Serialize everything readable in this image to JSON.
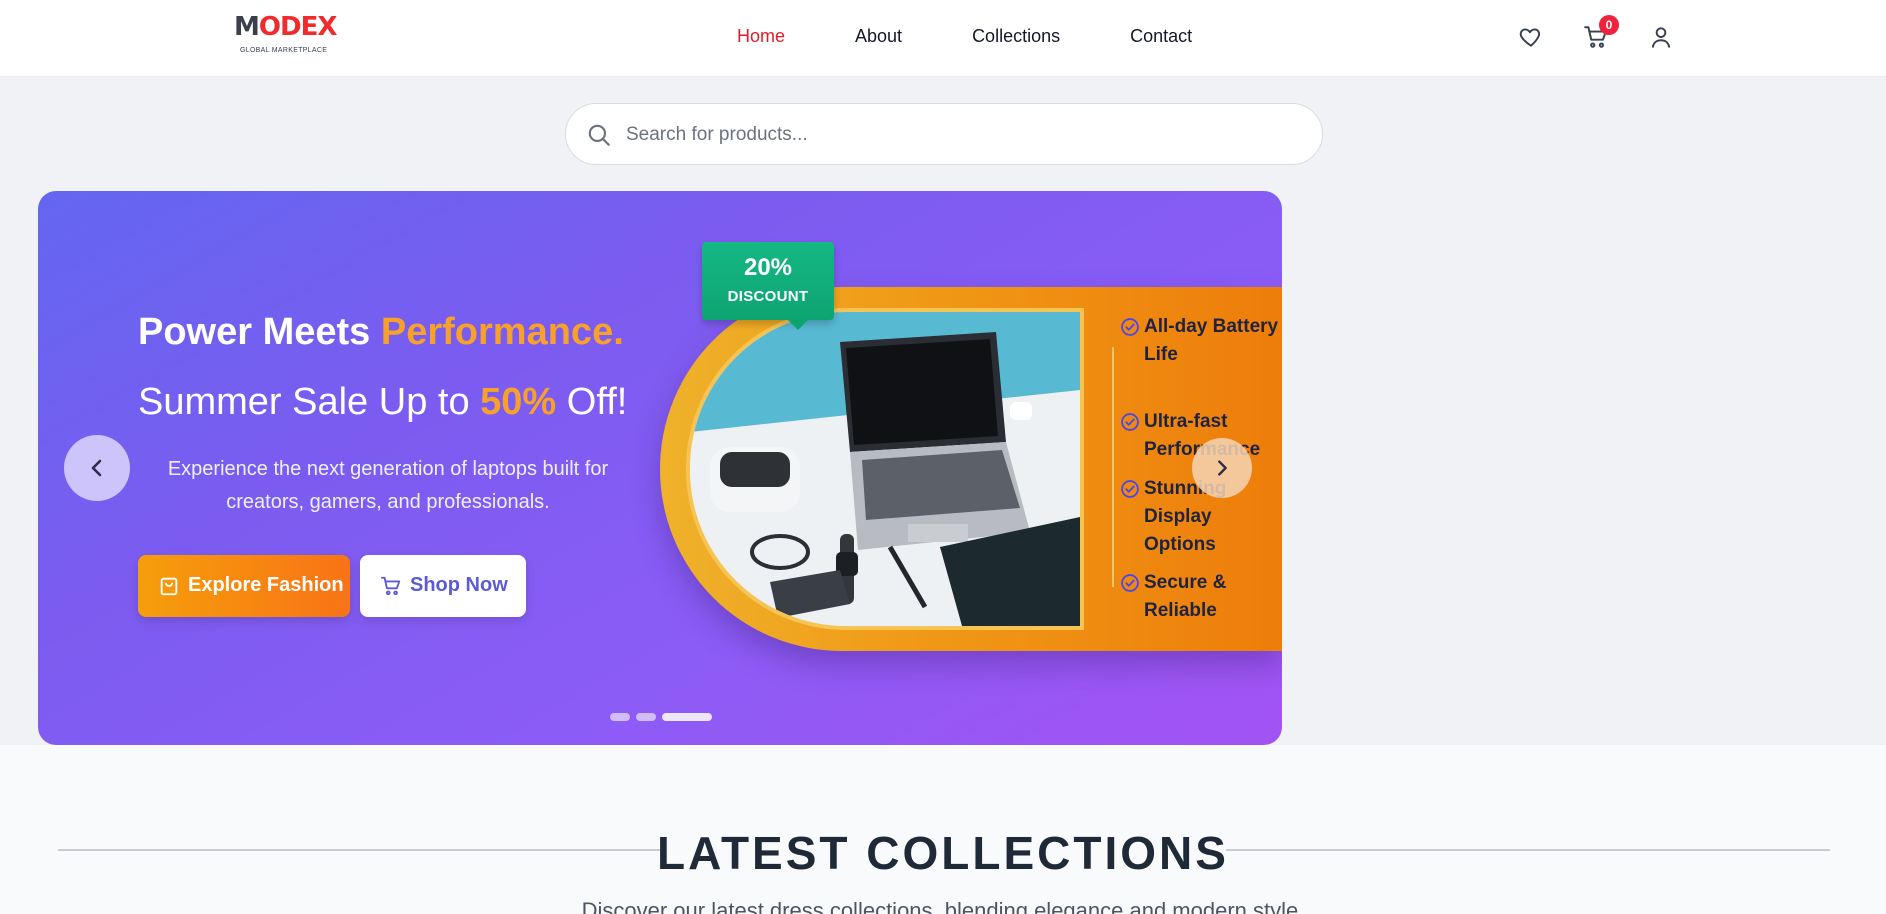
{
  "brand": {
    "logo_text": "MODEX",
    "tagline": "GLOBAL MARKETPLACE",
    "accent": "#ef2b2d"
  },
  "nav": {
    "links": [
      {
        "label": "Home",
        "active": true
      },
      {
        "label": "About",
        "active": false
      },
      {
        "label": "Collections",
        "active": false
      },
      {
        "label": "Contact",
        "active": false
      }
    ],
    "icons": [
      "heart-icon",
      "cart-icon",
      "user-icon"
    ],
    "cart_count": "0"
  },
  "search": {
    "placeholder": "Search for products...",
    "value": ""
  },
  "hero": {
    "title_plain": "Power Meets ",
    "title_accent": "Performance.",
    "subtitle_prefix": "Summer Sale Up to ",
    "subtitle_accent": "50%",
    "subtitle_suffix": " Off!",
    "description": "Experience the next generation of laptops built for creators, gamers, and professionals.",
    "primary_button": "Explore Fashion",
    "secondary_button": "Shop Now",
    "badge_percent": "20%",
    "badge_label": "DISCOUNT",
    "features": [
      "All-day Battery Life",
      "Ultra-fast Performance",
      "Stunning Display Options",
      "Secure & Reliable"
    ],
    "slide_count": 3,
    "active_slide": 3,
    "colors": {
      "accent": "#f7a12a",
      "badge": "#10b07c",
      "gradient_start": "#6366f1",
      "gradient_end": "#a353f3"
    }
  },
  "collections": {
    "title": "LATEST COLLECTIONS",
    "subtitle": "Discover our latest dress collections, blending elegance and modern style."
  }
}
